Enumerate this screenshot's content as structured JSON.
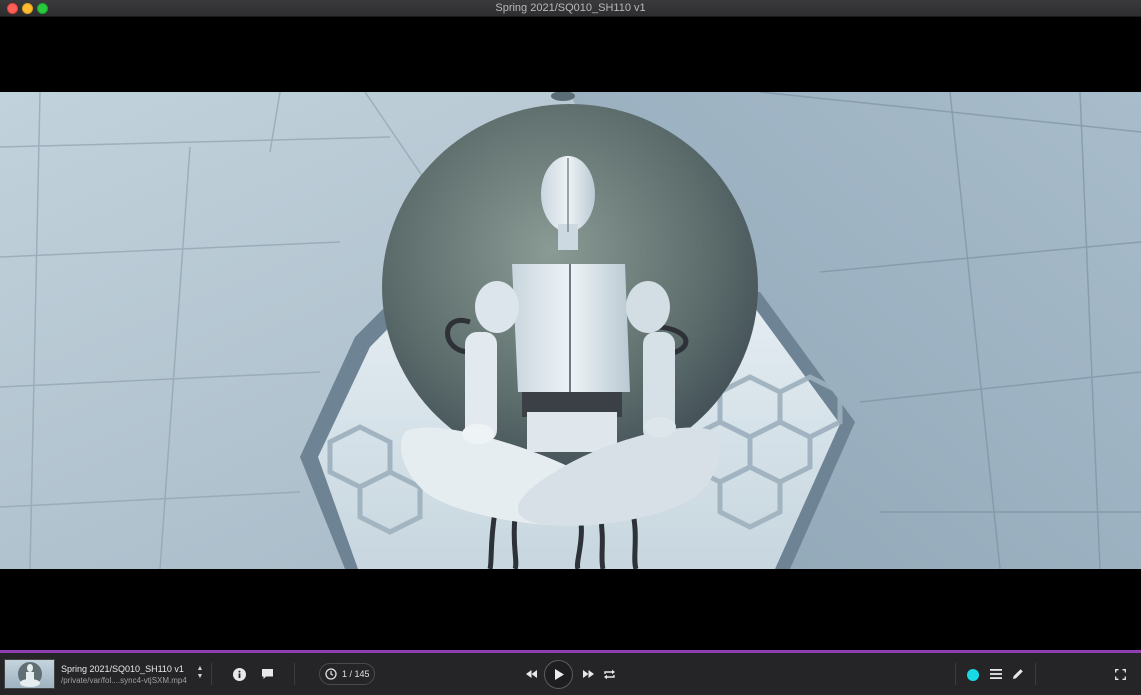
{
  "window": {
    "title": "Spring 2021/SQ010_SH110 v1"
  },
  "player": {
    "clip_name": "Spring 2021/SQ010_SH110 v1",
    "clip_path": "/private/var/fol....sync4-vtjSXM.mp4",
    "frame_counter": "1 / 145",
    "progress": 1.0,
    "progress_color": "#8e3fb0",
    "annotation_color": "#19d8e6",
    "icons": {
      "info": "info-icon",
      "comments": "comment-icon",
      "clock": "clock-icon",
      "rewind": "rewind-icon",
      "play": "play-icon",
      "forward": "fast-forward-icon",
      "loop": "loop-icon",
      "menu": "menu-icon",
      "pencil": "pencil-icon",
      "fullscreen": "fullscreen-icon"
    }
  }
}
